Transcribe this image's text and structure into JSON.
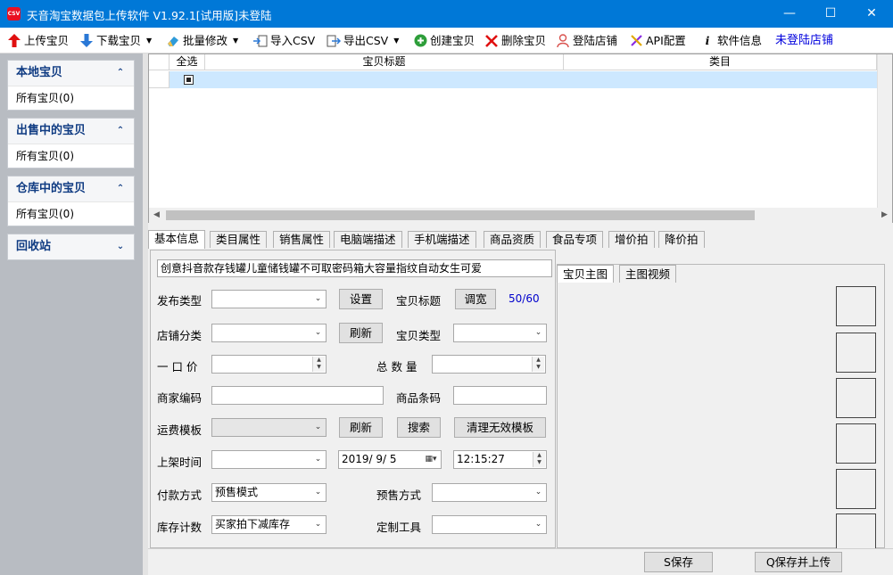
{
  "window": {
    "title": "天音淘宝数据包上传软件 V1.92.1[试用版]未登陆",
    "app_icon_text": "CSV",
    "minimize": "—",
    "maximize": "☐",
    "close": "✕"
  },
  "toolbar": {
    "upload": "上传宝贝",
    "download": "下载宝贝",
    "batch_edit": "批量修改",
    "import_csv": "导入CSV",
    "export_csv": "导出CSV",
    "create": "创建宝贝",
    "delete": "删除宝贝",
    "login_shop": "登陆店铺",
    "api_config": "API配置",
    "software_info": "软件信息",
    "status": "未登陆店铺"
  },
  "sidebar": {
    "groups": [
      {
        "title": "本地宝贝",
        "item": "所有宝贝(0)"
      },
      {
        "title": "出售中的宝贝",
        "item": "所有宝贝(0)"
      },
      {
        "title": "仓库中的宝贝",
        "item": "所有宝贝(0)"
      },
      {
        "title": "回收站"
      }
    ],
    "collapse_glyph": "⌃",
    "expand_glyph": "⌄"
  },
  "grid": {
    "columns": [
      "全选",
      "宝贝标题",
      "类目"
    ]
  },
  "tabs": [
    "基本信息",
    "类目属性",
    "销售属性",
    "电脑端描述",
    "手机端描述",
    "商品资质",
    "食品专项",
    "增价拍",
    "降价拍"
  ],
  "form": {
    "title_value": "创意抖音款存钱罐儿童储钱罐不可取密码箱大容量指纹自动女生可爱",
    "publish_type": "发布类型",
    "shop_category": "店铺分类",
    "price": "一 口 价",
    "merchant_code": "商家编码",
    "shipping_template": "运费模板",
    "listing_time": "上架时间",
    "payment_method": "付款方式",
    "stock_count": "库存计数",
    "item_title": "宝贝标题",
    "item_type": "宝贝类型",
    "total_qty": "总 数 量",
    "barcode": "商品条码",
    "presale_method": "预售方式",
    "custom_tool": "定制工具",
    "title_count": "50/60",
    "date_value": "2019/ 9/ 5",
    "time_value": "12:15:27",
    "payment_value": "预售模式",
    "stock_value": "买家拍下减库存",
    "btn_settings": "设置",
    "btn_adjust": "调宽",
    "btn_refresh1": "刷新",
    "btn_refresh2": "刷新",
    "btn_search": "搜索",
    "btn_clear": "清理无效模板"
  },
  "media": {
    "tabs": [
      "宝贝主图",
      "主图视频"
    ]
  },
  "footer": {
    "save": "S保存",
    "save_upload": "Q保存并上传"
  }
}
